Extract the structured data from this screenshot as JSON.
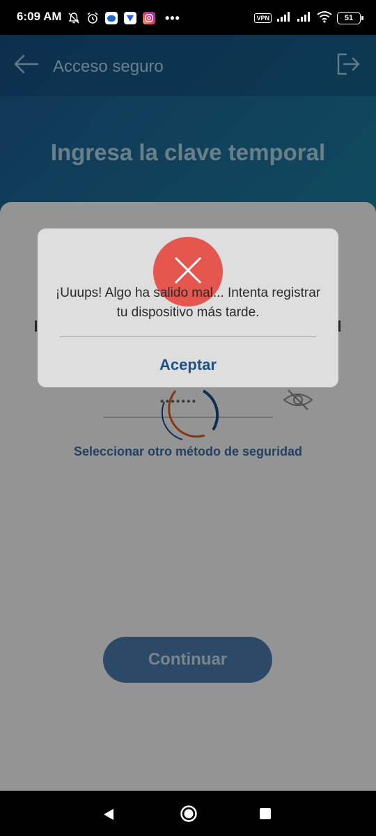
{
  "status_bar": {
    "time": "6:09 AM",
    "dots": "•••",
    "vpn_label": "VPN",
    "battery": "51",
    "icons": [
      "bell-off-icon",
      "alarm-icon",
      "chat-app-icon",
      "shield-app-icon",
      "instagram-icon",
      "signal-icon",
      "signal-icon",
      "wifi-icon",
      "battery-icon"
    ]
  },
  "app_bar": {
    "title": "Acceso seguro",
    "back_icon": "arrow-left-icon",
    "logout_icon": "logout-icon"
  },
  "page": {
    "heading": "Ingresa la clave temporal",
    "otp_mask": "•••••••",
    "eye_icon": "eye-off-icon",
    "alt_method_link": "Seleccionar otro método de seguridad",
    "continue_label": "Continuar"
  },
  "dialog": {
    "icon": "close-x-icon",
    "message": "¡Uuups! Algo ha salido mal... Intenta registrar tu dispositivo más tarde.",
    "accept_label": "Aceptar"
  },
  "colors": {
    "header_gradient_start": "#1e5e95",
    "header_gradient_end": "#2fa2b8",
    "error_red": "#e5564e",
    "link_blue": "#1d4f86",
    "button_blue": "#4d7fb4",
    "spinner_orange": "#e2621b",
    "spinner_blue": "#1b4f8c"
  }
}
